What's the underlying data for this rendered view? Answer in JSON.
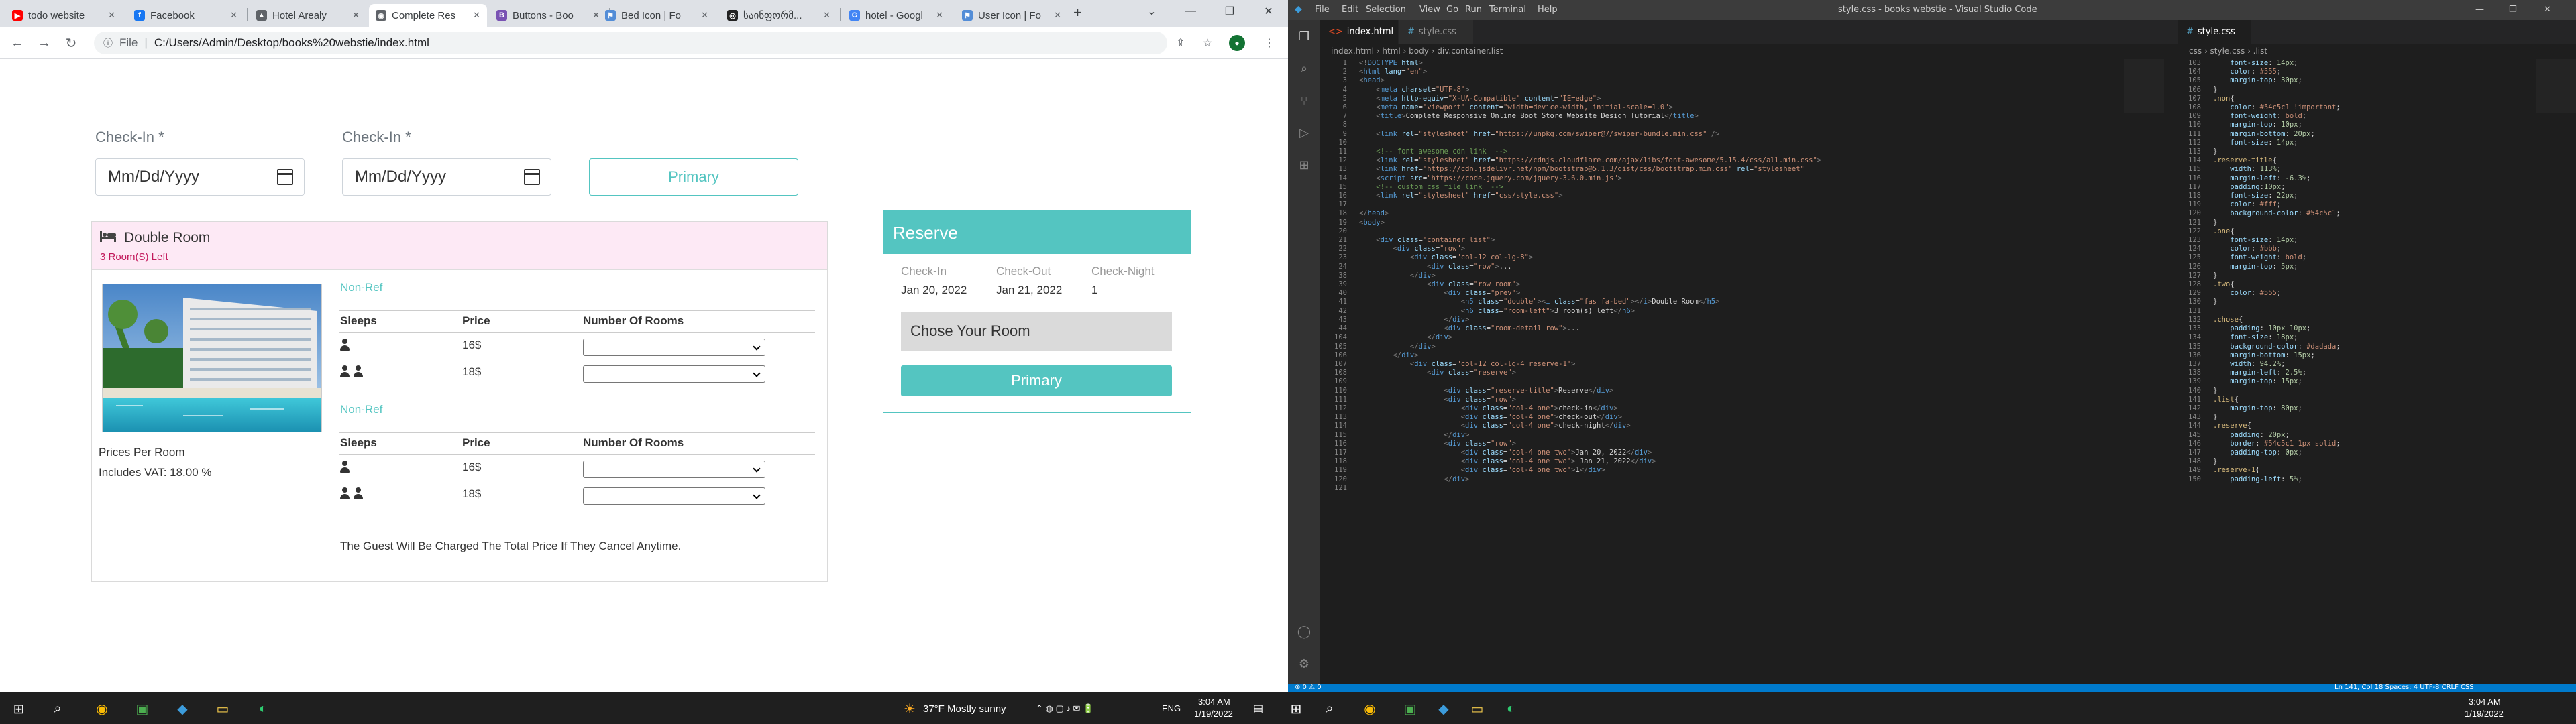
{
  "browser": {
    "tabs": [
      {
        "label": "todo website",
        "color": "#ff0000",
        "glyph": "▶"
      },
      {
        "label": "Facebook",
        "color": "#1877f2",
        "glyph": "f"
      },
      {
        "label": "Hotel Arealy",
        "color": "#5f6368",
        "glyph": "▲"
      },
      {
        "label": "Complete Res",
        "color": "#5f6368",
        "glyph": "◉"
      },
      {
        "label": "Buttons - Boo",
        "color": "#7952b3",
        "glyph": "B"
      },
      {
        "label": "Bed Icon | Fo",
        "color": "#538dd7",
        "glyph": "⚑"
      },
      {
        "label": "საინფორმ...",
        "color": "#222",
        "glyph": "◎"
      },
      {
        "label": "hotel - Googl",
        "color": "#4285f4",
        "glyph": "G"
      },
      {
        "label": "User Icon | Fo",
        "color": "#538dd7",
        "glyph": "⚑"
      }
    ],
    "url_prefix": "File",
    "url": "C:/Users/Admin/Desktop/books%20webstie/index.html"
  },
  "page": {
    "checkin1_label": "Check-In *",
    "checkin2_label": "Check-In *",
    "date_placeholder": "Mm/Dd/Yyyy",
    "primary_button": "Primary",
    "room": {
      "title": "Double Room",
      "rooms_left": "3 Room(S) Left",
      "prices_per_room": "Prices Per Room",
      "includes_vat": "Includes VAT: 18.00 %",
      "rates": [
        {
          "label": "Non-Ref",
          "headers": [
            "Sleeps",
            "Price",
            "Number Of Rooms"
          ],
          "rows": [
            {
              "price": "16$"
            },
            {
              "price": "18$"
            }
          ]
        },
        {
          "label": "Non-Ref",
          "headers": [
            "Sleeps",
            "Price",
            "Number Of Rooms"
          ],
          "rows": [
            {
              "price": "16$"
            },
            {
              "price": "18$"
            }
          ]
        }
      ],
      "guest_note": "The Guest Will Be Charged The Total Price If They Cancel Anytime."
    },
    "reserve": {
      "title": "Reserve",
      "labels": [
        "Check-In",
        "Check-Out",
        "Check-Night"
      ],
      "values": [
        "Jan 20, 2022",
        "Jan 21, 2022",
        "1"
      ],
      "chose": "Chose Your Room",
      "button": "Primary"
    }
  },
  "vscode": {
    "title": "style.css - books webstie - Visual Studio Code",
    "menus": [
      "File",
      "Edit",
      "Selection",
      "View",
      "Go",
      "Run",
      "Terminal",
      "Help"
    ],
    "left_tabs": [
      "index.html",
      "style.css"
    ],
    "right_tab": "style.css",
    "left_breadcrumb": "index.html › html › body › div.container.list",
    "right_breadcrumb": "css › style.css › .list",
    "status_left": "⊗ 0 ⚠ 0",
    "status_right": "Ln 141, Col 18   Spaces: 4   UTF-8   CRLF   CSS"
  },
  "taskbar": {
    "weather": "37°F  Mostly sunny",
    "lang": "ENG",
    "time": "3:04 AM",
    "date": "1/19/2022"
  },
  "colors": {
    "accent": "#54c5c1",
    "pink": "#fde9f5",
    "vscode_blue": "#007acc"
  }
}
